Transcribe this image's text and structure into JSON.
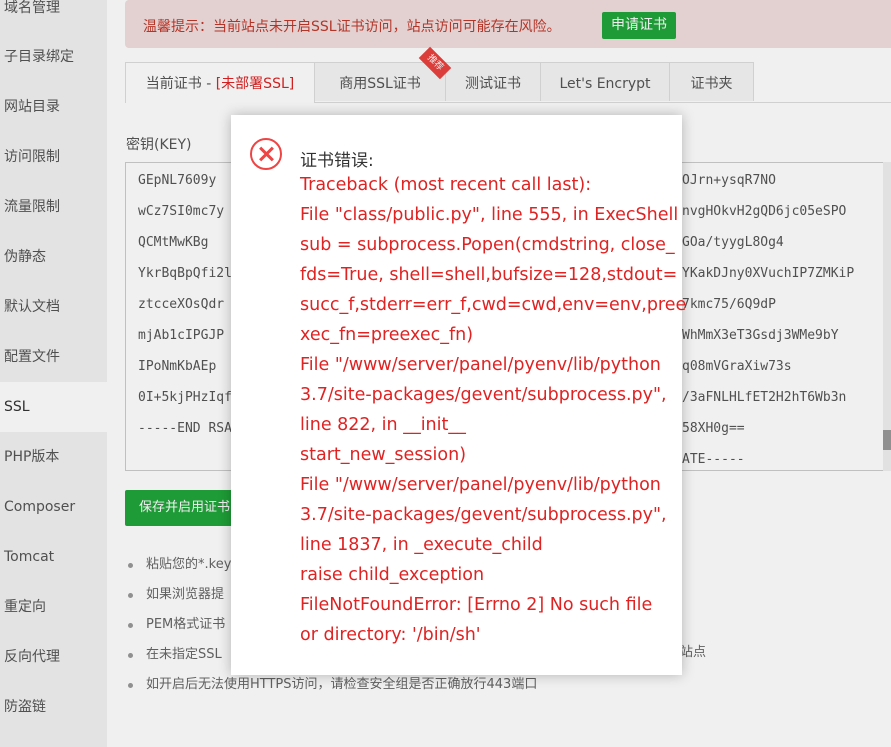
{
  "sidebar": {
    "items": [
      {
        "label": "域名管理"
      },
      {
        "label": "子目录绑定"
      },
      {
        "label": "网站目录"
      },
      {
        "label": "访问限制"
      },
      {
        "label": "流量限制"
      },
      {
        "label": "伪静态"
      },
      {
        "label": "默认文档"
      },
      {
        "label": "配置文件"
      },
      {
        "label": "SSL"
      },
      {
        "label": "PHP版本"
      },
      {
        "label": "Composer"
      },
      {
        "label": "Tomcat"
      },
      {
        "label": "重定向"
      },
      {
        "label": "反向代理"
      },
      {
        "label": "防盗链"
      }
    ],
    "active": "SSL"
  },
  "banner": {
    "text": "温馨提示：当前站点未开启SSL证书访问，站点访问可能存在风险。",
    "button": "申请证书"
  },
  "tabs": {
    "current_prefix": "当前证书 - ",
    "current_status": "[未部署SSL]",
    "commercial": "商用SSL证书",
    "ribbon": "推荐",
    "test": "测试证书",
    "letsencrypt": "Let's Encrypt",
    "folder": "证书夹"
  },
  "key": {
    "label": "密钥(KEY)",
    "lines_left": [
      "GEpNL7609y",
      "wCz7SI0mc7y",
      "QCMtMwKBg",
      "YkrBqBpQfi2l",
      "ztcceXOsQdr",
      "mjAb1cIPGJP",
      "IPoNmKbAEp",
      "0I+5kjPHzIqf",
      "-----END RSA"
    ],
    "lines_right": [
      "OJrn+ysqR7NO",
      "nvgHOkvH2gQD6jc05eSPO",
      "GOa/tyygL8Og4",
      "YKakDJny0XVuchIP7ZMKiP",
      "7kmc75/6Q9dP",
      "WhMmX3eT3Gsdj3WMe9bY",
      "q08mVGraXiw73s",
      "/3aFNLHLfET2H2hT6Wb3n",
      "58XH0g==",
      "ATE-----"
    ]
  },
  "save_button": "保存并启用证书",
  "notes": [
    "粘贴您的*.key",
    "如果浏览器提",
    "PEM格式证书",
    "在未指定SSL",
    "如开启后无法使用HTTPS访问，请检查安全组是否正确放行443端口"
  ],
  "note_tail": "站点",
  "dialog": {
    "title": "证书错误:",
    "lines": [
      "Traceback (most recent call last):",
      "File \"class/public.py\", line 555, in ExecShell",
      "sub = subprocess.Popen(cmdstring, close_",
      "fds=True, shell=shell,bufsize=128,stdout=",
      "succ_f,stderr=err_f,cwd=cwd,env=env,pree",
      "xec_fn=preexec_fn)",
      "File \"/www/server/panel/pyenv/lib/python",
      "3.7/site-packages/gevent/subprocess.py\",",
      "line 822, in __init__",
      "start_new_session)",
      "File \"/www/server/panel/pyenv/lib/python",
      "3.7/site-packages/gevent/subprocess.py\",",
      "line 1837, in _execute_child",
      "raise child_exception",
      "FileNotFoundError: [Errno 2] No such file",
      "or directory: '/bin/sh'"
    ]
  },
  "colors": {
    "accent": "#20a53a",
    "error": "#e02222",
    "banner_bg": "#f2dede"
  }
}
